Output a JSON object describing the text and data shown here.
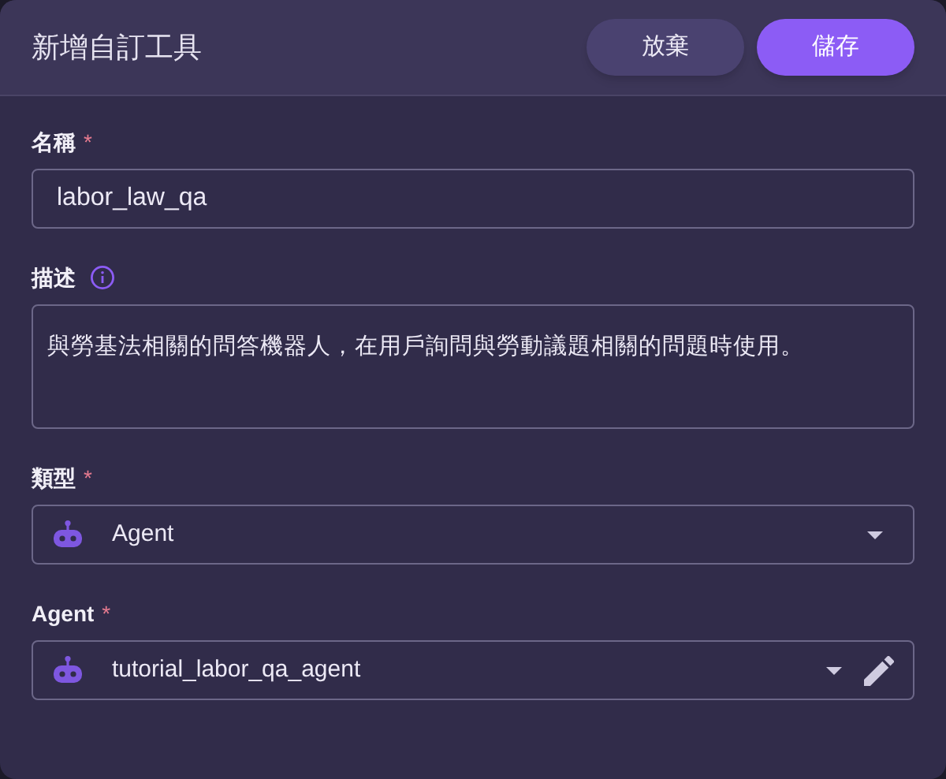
{
  "dialog": {
    "title": "新增自訂工具"
  },
  "buttons": [
    {
      "label": "放棄",
      "kind": "secondary"
    },
    {
      "label": "儲存",
      "kind": "primary"
    }
  ],
  "fields": [
    {
      "kind": "text",
      "label": "名稱",
      "required_mark": "*",
      "value": "labor_law_qa"
    },
    {
      "kind": "textarea",
      "label": "描述",
      "info": true,
      "value": "與勞基法相關的問答機器人，在用戶詢問與勞動議題相關的問題時使用。"
    },
    {
      "kind": "select",
      "label": "類型",
      "required_mark": "*",
      "value": "Agent",
      "editable": false
    },
    {
      "kind": "select",
      "label": "Agent",
      "required_mark": "*",
      "value": "tutorial_labor_qa_agent",
      "editable": true
    }
  ]
}
